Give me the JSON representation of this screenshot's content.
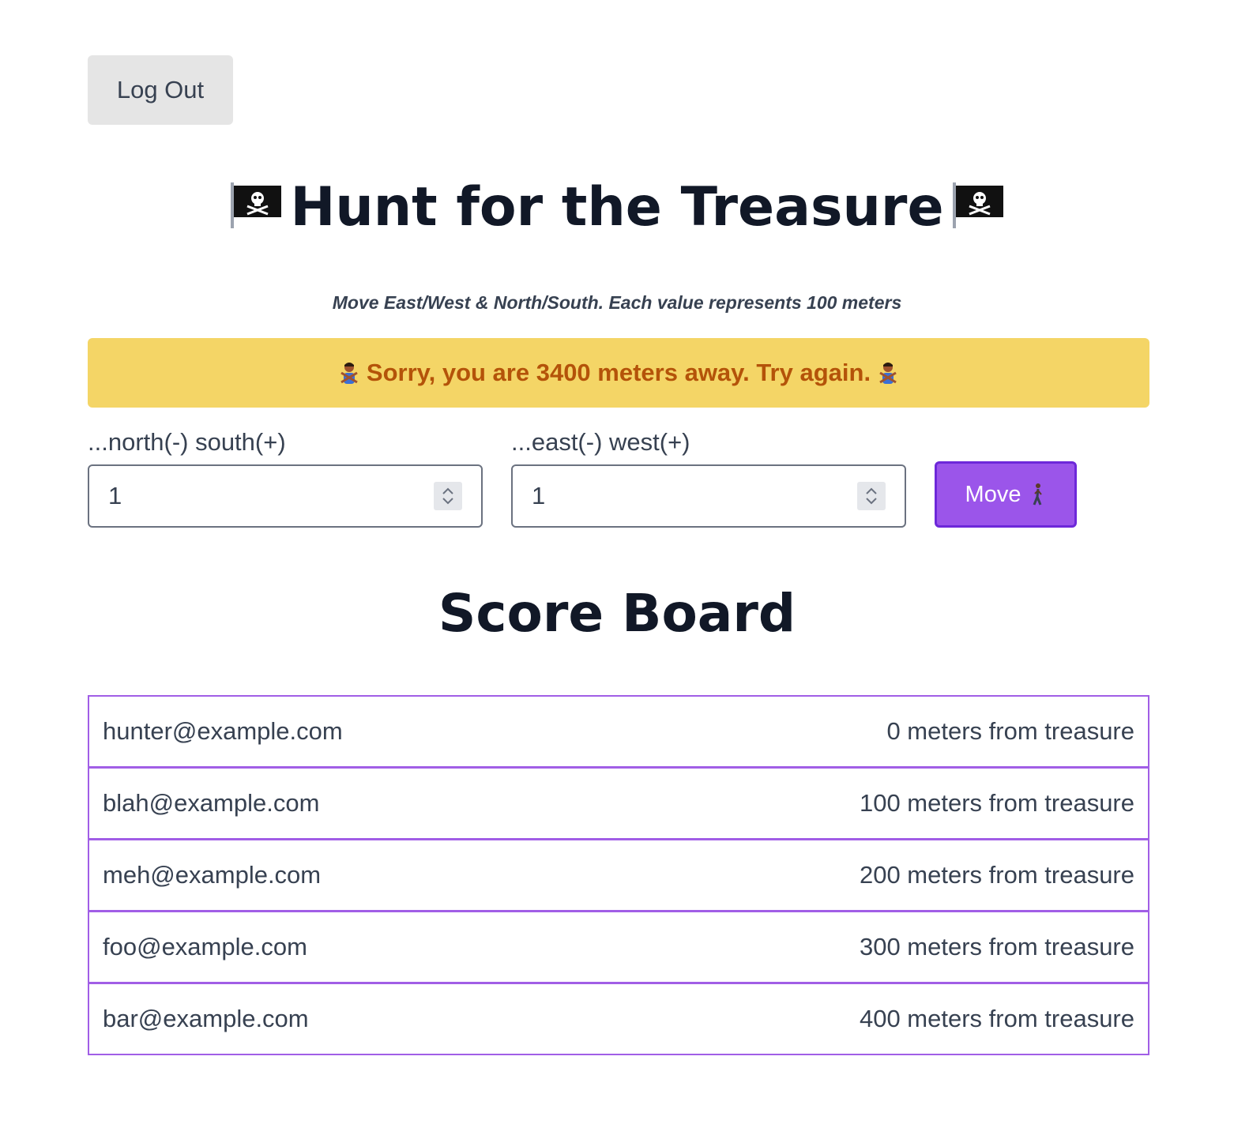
{
  "header": {
    "logout_label": "Log Out"
  },
  "game": {
    "title": "Hunt for the Treasure",
    "subtitle": "Move East/West & North/South. Each value represents 100 meters",
    "alert_text": "Sorry, you are 3400 meters away. Try again.",
    "north_south_label": "...north(-) south(+)",
    "north_south_value": "1",
    "east_west_label": "...east(-) west(+)",
    "east_west_value": "1",
    "move_label": "Move"
  },
  "scoreboard": {
    "title": "Score Board",
    "rows": [
      {
        "email": "hunter@example.com",
        "distance": "0 meters from treasure"
      },
      {
        "email": "blah@example.com",
        "distance": "100 meters from treasure"
      },
      {
        "email": "meh@example.com",
        "distance": "200 meters from treasure"
      },
      {
        "email": "foo@example.com",
        "distance": "300 meters from treasure"
      },
      {
        "email": "bar@example.com",
        "distance": "400 meters from treasure"
      }
    ]
  },
  "icons": {
    "title_icon": "pirate-flag-icon",
    "alert_icon": "person-gesturing-no-icon",
    "move_icon": "person-walking-icon"
  },
  "colors": {
    "alert_bg": "#f4d566",
    "alert_text": "#b45309",
    "accent": "#9b55ea",
    "table_border": "#a15ee6"
  }
}
